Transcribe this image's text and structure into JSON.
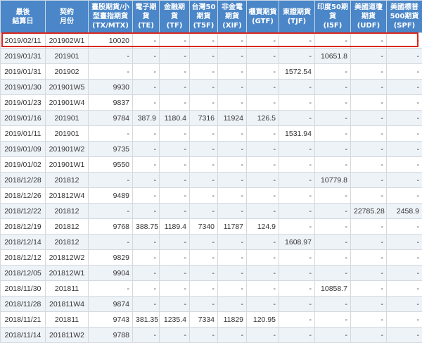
{
  "table": {
    "headers": [
      "最後\n結算日",
      "契約\n月份",
      "臺股期貨/小\n型臺指期貨\n(TX/MTX)",
      "電子期\n貨\n(TE)",
      "金融期\n貨\n(TF)",
      "台灣50\n期貨\n(T5F)",
      "非金電\n期貨\n(XIF)",
      "櫃買期貨\n(GTF)",
      "東證期貨\n(TJF)",
      "印度50期\n貨\n(I5F)",
      "美國道瓊\n期貨\n(UDF)",
      "美國標普\n500期貨\n(SPF)"
    ],
    "rows": [
      [
        "2019/02/11",
        "201902W1",
        "10020",
        "-",
        "-",
        "-",
        "-",
        "-",
        "-",
        "-",
        "-",
        "-"
      ],
      [
        "2019/01/31",
        "201901",
        "-",
        "-",
        "-",
        "-",
        "-",
        "-",
        "-",
        "10651.8",
        "-",
        "-"
      ],
      [
        "2019/01/31",
        "201902",
        "-",
        "-",
        "-",
        "-",
        "-",
        "-",
        "1572.54",
        "-",
        "-",
        "-"
      ],
      [
        "2019/01/30",
        "201901W5",
        "9930",
        "-",
        "-",
        "-",
        "-",
        "-",
        "-",
        "-",
        "-",
        "-"
      ],
      [
        "2019/01/23",
        "201901W4",
        "9837",
        "-",
        "-",
        "-",
        "-",
        "-",
        "-",
        "-",
        "-",
        "-"
      ],
      [
        "2019/01/16",
        "201901",
        "9784",
        "387.9",
        "1180.4",
        "7316",
        "11924",
        "126.5",
        "-",
        "-",
        "-",
        "-"
      ],
      [
        "2019/01/11",
        "201901",
        "-",
        "-",
        "-",
        "-",
        "-",
        "-",
        "1531.94",
        "-",
        "-",
        "-"
      ],
      [
        "2019/01/09",
        "201901W2",
        "9735",
        "-",
        "-",
        "-",
        "-",
        "-",
        "-",
        "-",
        "-",
        "-"
      ],
      [
        "2019/01/02",
        "201901W1",
        "9550",
        "-",
        "-",
        "-",
        "-",
        "-",
        "-",
        "-",
        "-",
        "-"
      ],
      [
        "2018/12/28",
        "201812",
        "-",
        "-",
        "-",
        "-",
        "-",
        "-",
        "-",
        "10779.8",
        "-",
        "-"
      ],
      [
        "2018/12/26",
        "201812W4",
        "9489",
        "-",
        "-",
        "-",
        "-",
        "-",
        "-",
        "-",
        "-",
        "-"
      ],
      [
        "2018/12/22",
        "201812",
        "-",
        "-",
        "-",
        "-",
        "-",
        "-",
        "-",
        "-",
        "22785.28",
        "2458.9"
      ],
      [
        "2018/12/19",
        "201812",
        "9768",
        "388.75",
        "1189.4",
        "7340",
        "11787",
        "124.9",
        "-",
        "-",
        "-",
        "-"
      ],
      [
        "2018/12/14",
        "201812",
        "-",
        "-",
        "-",
        "-",
        "-",
        "-",
        "1608.97",
        "-",
        "-",
        "-"
      ],
      [
        "2018/12/12",
        "201812W2",
        "9829",
        "-",
        "-",
        "-",
        "-",
        "-",
        "-",
        "-",
        "-",
        "-"
      ],
      [
        "2018/12/05",
        "201812W1",
        "9904",
        "-",
        "-",
        "-",
        "-",
        "-",
        "-",
        "-",
        "-",
        "-"
      ],
      [
        "2018/11/30",
        "201811",
        "-",
        "-",
        "-",
        "-",
        "-",
        "-",
        "-",
        "10858.7",
        "-",
        "-"
      ],
      [
        "2018/11/28",
        "201811W4",
        "9874",
        "-",
        "-",
        "-",
        "-",
        "-",
        "-",
        "-",
        "-",
        "-"
      ],
      [
        "2018/11/21",
        "201811",
        "9743",
        "381.35",
        "1235.4",
        "7334",
        "11829",
        "120.95",
        "-",
        "-",
        "-",
        "-"
      ],
      [
        "2018/11/14",
        "201811W2",
        "9788",
        "-",
        "-",
        "-",
        "-",
        "-",
        "-",
        "-",
        "-",
        "-"
      ]
    ]
  },
  "colors": {
    "header_bg": "#4a86c8",
    "header_text": "#ffffff",
    "highlight_border": "#d9261c",
    "row_alt_bg": "#eef3f8"
  }
}
